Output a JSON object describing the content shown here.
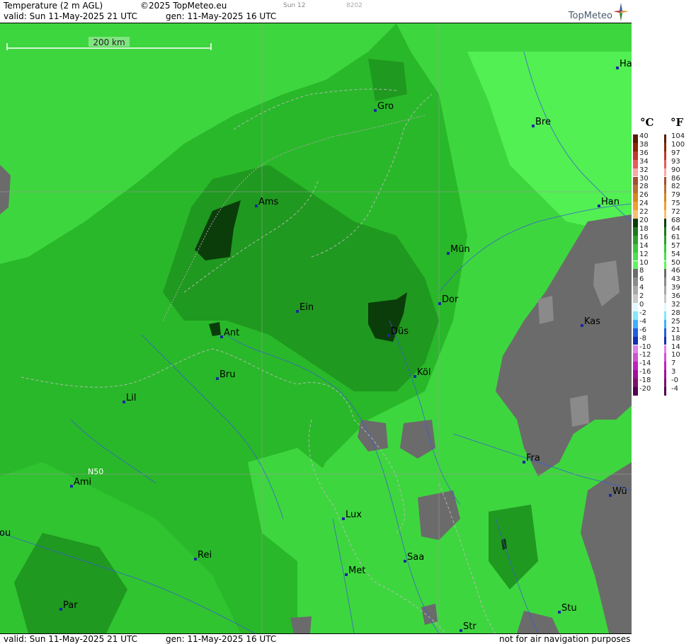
{
  "header": {
    "title": "Temperature (2 m AGL)",
    "copyright": "©2025 TopMeteo.eu",
    "day_code": "Sun 12",
    "run_code": "8202",
    "valid": "valid:  Sun  11-May-2025  21 UTC",
    "generated": "gen: 11-May-2025 16 UTC",
    "brand": "TopMeteo"
  },
  "footer": {
    "valid": "valid:  Sun  11-May-2025  21 UTC",
    "generated": "gen: 11-May-2025 16 UTC",
    "disclaimer": "not for air navigation purposes"
  },
  "map": {
    "scale_label": "200 km",
    "lat_label": "N50",
    "cities": [
      {
        "name": "Ha"
      },
      {
        "name": "Gro"
      },
      {
        "name": "Bre"
      },
      {
        "name": "Ams"
      },
      {
        "name": "Han"
      },
      {
        "name": "Mün"
      },
      {
        "name": "Dor"
      },
      {
        "name": "Ein"
      },
      {
        "name": "Kas"
      },
      {
        "name": "Ant"
      },
      {
        "name": "Düs"
      },
      {
        "name": "Köl"
      },
      {
        "name": "Bru"
      },
      {
        "name": "Lil"
      },
      {
        "name": "Fra"
      },
      {
        "name": "Ami"
      },
      {
        "name": "Wü"
      },
      {
        "name": "Lux"
      },
      {
        "name": "ou"
      },
      {
        "name": "Rei"
      },
      {
        "name": "Saa"
      },
      {
        "name": "Met"
      },
      {
        "name": "Par"
      },
      {
        "name": "Stu"
      },
      {
        "name": "Str"
      }
    ]
  },
  "legend": {
    "unit_c": "°C",
    "unit_f": "°F",
    "celsius": [
      "40",
      "38",
      "36",
      "34",
      "32",
      "30",
      "28",
      "26",
      "24",
      "22",
      "20",
      "18",
      "16",
      "14",
      "12",
      "10",
      "8",
      "6",
      "4",
      "2",
      "0",
      "-2",
      "-4",
      "-6",
      "-8",
      "-10",
      "-12",
      "-14",
      "-16",
      "-18",
      "-20"
    ],
    "fahrenheit": [
      "104",
      "100",
      "97",
      "93",
      "90",
      "86",
      "82",
      "79",
      "75",
      "72",
      "68",
      "64",
      "61",
      "57",
      "54",
      "50",
      "46",
      "43",
      "39",
      "36",
      "32",
      "28",
      "25",
      "21",
      "18",
      "14",
      "10",
      "7",
      "3",
      "-0",
      "-4"
    ],
    "colors": [
      "#5a1a00",
      "#8b2500",
      "#c0392b",
      "#e85a5a",
      "#f7a8a8",
      "#a0522d",
      "#b8732f",
      "#d4891a",
      "#f0a030",
      "#f7c070",
      "#0b3d0b",
      "#1e7a1e",
      "#2ea02e",
      "#3cc83c",
      "#4be04b",
      "#5ef55e",
      "#6b6b6b",
      "#8a8a8a",
      "#a8a8a8",
      "#c8c8c8",
      "#e0f8ff",
      "#80e8ff",
      "#40b0ff",
      "#2060e0",
      "#1030b0",
      "#e080e8",
      "#d050d0",
      "#c020c0",
      "#a0109a",
      "#80106a",
      "#500050"
    ]
  }
}
